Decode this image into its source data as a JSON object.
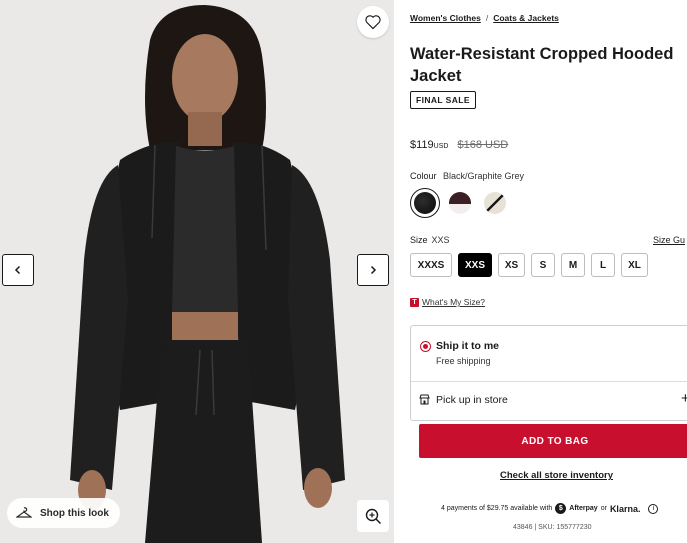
{
  "breadcrumb": [
    {
      "label": "Women's Clothes"
    },
    {
      "label": "Coats & Jackets"
    }
  ],
  "breadcrumb_separator": "/",
  "product": {
    "title": "Water-Resistant Cropped Hooded Jacket",
    "badge": "FINAL SALE",
    "price_now": "$119",
    "price_currency": "USD",
    "price_was": "$168 USD"
  },
  "colour": {
    "label": "Colour",
    "selected": "Black/Graphite Grey",
    "swatches": [
      {
        "name": "black-graphite-grey",
        "primary": "#1c1c1c",
        "secondary": "#2e2e2e"
      },
      {
        "name": "burgundy-white",
        "primary": "#3a1f25",
        "secondary": "#f2eeee"
      },
      {
        "name": "cream-black",
        "primary": "#e8e2d6",
        "secondary": "#1a1a1a"
      }
    ]
  },
  "size": {
    "label": "Size",
    "selected": "XXS",
    "guide_label": "Size Gu",
    "options": [
      "XXXS",
      "XXS",
      "XS",
      "S",
      "M",
      "L",
      "XL"
    ],
    "whats_my_size_icon_letter": "T",
    "whats_my_size": "What's My Size?"
  },
  "fulfilment": {
    "ship_title": "Ship it to me",
    "ship_sub": "Free shipping",
    "pickup_title": "Pick up in store",
    "pickup_expand": "+"
  },
  "actions": {
    "add_to_bag": "ADD TO BAG",
    "store_inventory": "Check all store inventory"
  },
  "payments": {
    "text": "4 payments of $29.75 available with",
    "afterpay_mark": "$",
    "afterpay": "Afterpay",
    "or": "or",
    "klarna": "Klarna."
  },
  "sku_line": "43846 | SKU: 155777230",
  "gallery": {
    "shop_this_look": "Shop this look"
  },
  "colors": {
    "accent": "#c8102e",
    "text": "#1a1a1a",
    "photo_bg": "#e9e8e6"
  }
}
